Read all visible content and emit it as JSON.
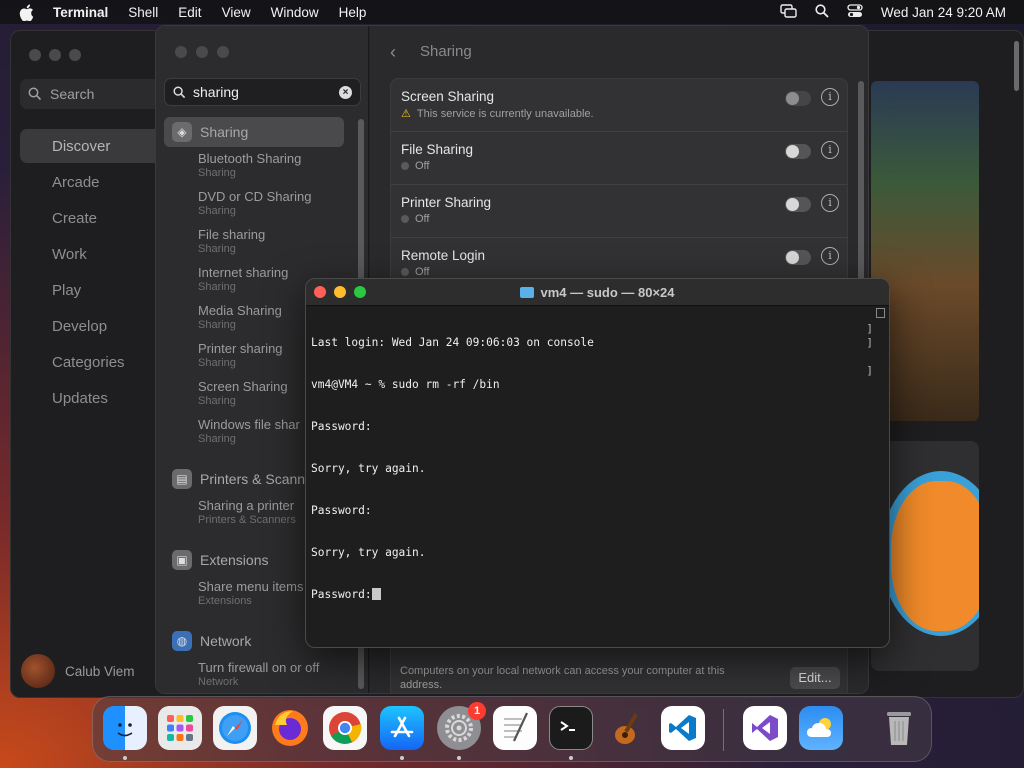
{
  "menubar": {
    "app": "Terminal",
    "items": [
      "Shell",
      "Edit",
      "View",
      "Window",
      "Help"
    ],
    "datetime": "Wed Jan 24  9:20 AM"
  },
  "appstore": {
    "search_placeholder": "Search",
    "nav": [
      "Discover",
      "Arcade",
      "Create",
      "Work",
      "Play",
      "Develop",
      "Categories",
      "Updates"
    ],
    "active_nav": "Discover",
    "user_name": "Calub Viem"
  },
  "settings": {
    "search_value": "sharing",
    "sidebar": {
      "sharing_label": "Sharing",
      "sharing_results": [
        {
          "title": "Bluetooth Sharing",
          "sub": "Sharing"
        },
        {
          "title": "DVD or CD Sharing",
          "sub": "Sharing"
        },
        {
          "title": "File sharing",
          "sub": "Sharing"
        },
        {
          "title": "Internet sharing",
          "sub": "Sharing"
        },
        {
          "title": "Media Sharing",
          "sub": "Sharing"
        },
        {
          "title": "Printer sharing",
          "sub": "Sharing"
        },
        {
          "title": "Screen Sharing",
          "sub": "Sharing"
        },
        {
          "title": "Windows file shar",
          "sub": "Sharing"
        }
      ],
      "printers_label": "Printers & Scanne",
      "printers_results": [
        {
          "title": "Sharing a printer",
          "sub": "Printers & Scanners"
        }
      ],
      "extensions_label": "Extensions",
      "extensions_results": [
        {
          "title": "Share menu items",
          "sub": "Extensions"
        }
      ],
      "network_label": "Network",
      "network_results": [
        {
          "title": "Turn firewall on or off",
          "sub": "Network"
        }
      ]
    },
    "detail": {
      "title": "Sharing",
      "rows": [
        {
          "name": "Screen Sharing",
          "status": "This service is currently unavailable.",
          "warning": true,
          "on": false
        },
        {
          "name": "File Sharing",
          "status": "Off",
          "warning": false,
          "on": false
        },
        {
          "name": "Printer Sharing",
          "status": "Off",
          "warning": false,
          "on": false
        },
        {
          "name": "Remote Login",
          "status": "Off",
          "warning": false,
          "on": false
        }
      ],
      "footnote": "Computers on your local network can access your computer at this address.",
      "edit_label": "Edit..."
    }
  },
  "terminal": {
    "title": "vm4 — sudo — 80×24",
    "lines": [
      "Last login: Wed Jan 24 09:06:03 on console",
      "vm4@VM4 ~ % sudo rm -rf /bin",
      "Password:",
      "Sorry, try again.",
      "Password:",
      "Sorry, try again.",
      "Password:"
    ]
  },
  "dock": {
    "apps": [
      {
        "name": "Finder",
        "icon": "finder-icon",
        "running": true
      },
      {
        "name": "Launchpad",
        "icon": "launchpad-icon",
        "running": false
      },
      {
        "name": "Safari",
        "icon": "safari-icon",
        "running": false
      },
      {
        "name": "Firefox",
        "icon": "firefox-icon",
        "running": false
      },
      {
        "name": "Chrome",
        "icon": "chrome-icon",
        "running": false
      },
      {
        "name": "App Store",
        "icon": "appstore-icon",
        "running": true
      },
      {
        "name": "System Settings",
        "icon": "settings-gear-icon",
        "running": true,
        "badge": "1"
      },
      {
        "name": "TextEdit",
        "icon": "textedit-icon",
        "running": false
      },
      {
        "name": "Terminal",
        "icon": "terminal-icon",
        "running": true
      },
      {
        "name": "GarageBand",
        "icon": "garageband-icon",
        "running": false
      },
      {
        "name": "VS Code",
        "icon": "vscode-icon",
        "running": false
      },
      {
        "name": "Visual Studio",
        "icon": "visualstudio-icon",
        "running": false
      },
      {
        "name": "Weather",
        "icon": "weather-icon",
        "running": false
      },
      {
        "name": "Trash",
        "icon": "trash-icon",
        "running": false
      }
    ]
  }
}
